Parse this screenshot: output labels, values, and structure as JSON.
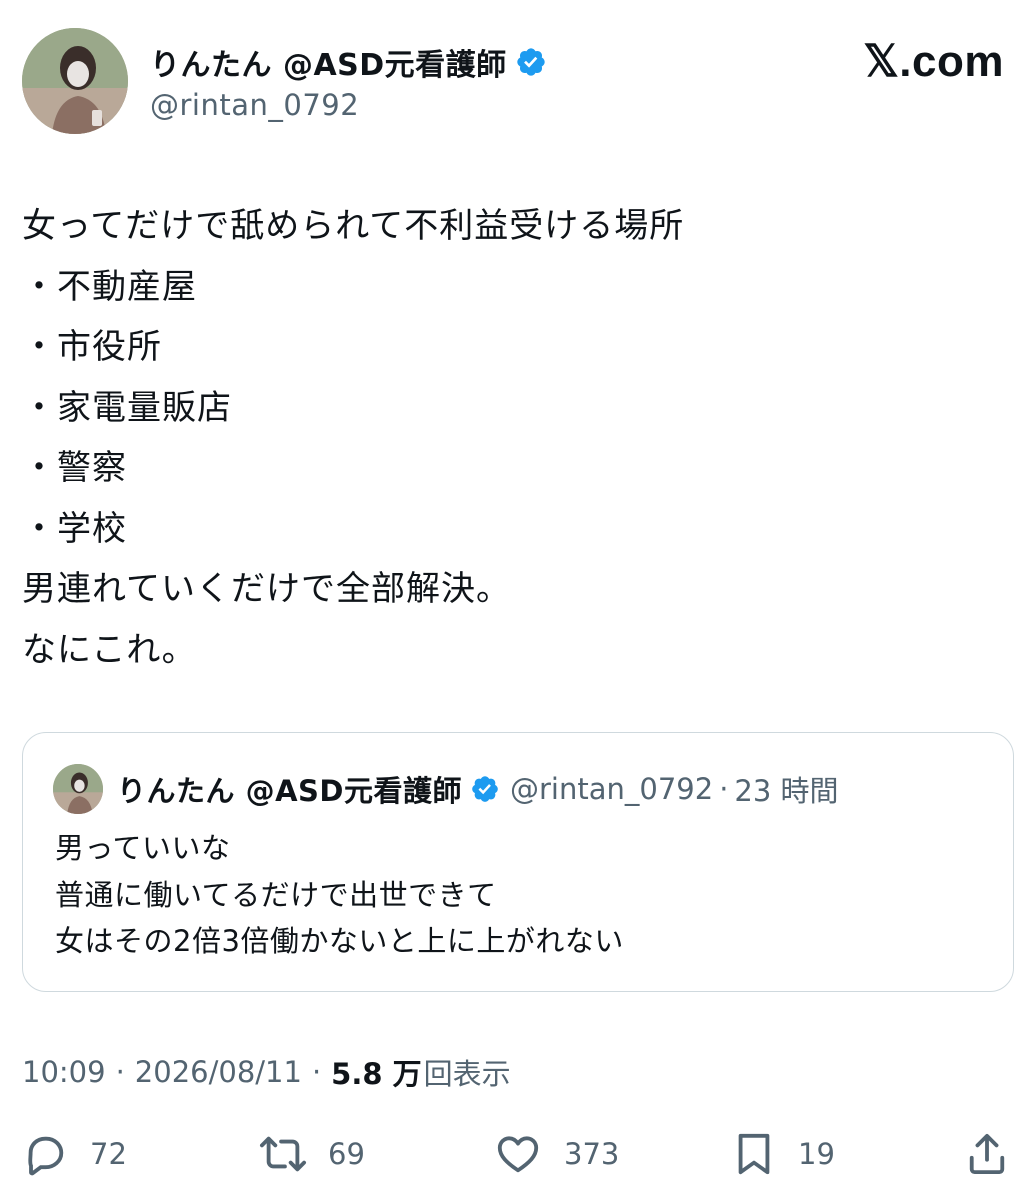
{
  "author": {
    "display_name": "りんたん @ASD元看護師",
    "handle": "@rintan_0792"
  },
  "brand": {
    "logo_text": "𝕏.com"
  },
  "tweet": {
    "lines": [
      "女ってだけで舐められて不利益受ける場所",
      "・不動産屋",
      "・市役所",
      "・家電量販店",
      "・警察",
      "・学校",
      "男連れていくだけで全部解決。",
      "なにこれ。"
    ]
  },
  "quote": {
    "display_name": "りんたん @ASD元看護師",
    "handle": "@rintan_0792",
    "separator": "·",
    "time": "23 時間",
    "lines": [
      "男っていいな",
      "普通に働いてるだけで出世できて",
      "女はその2倍3倍働かないと上に上がれない"
    ]
  },
  "meta": {
    "time": "10:09",
    "sep": "·",
    "date": "2026/08/11",
    "views_number": "5.8 万",
    "views_label": "回表示"
  },
  "actions": {
    "replies": "72",
    "reposts": "69",
    "likes": "373",
    "bookmarks": "19"
  },
  "colors": {
    "text": "#0f1419",
    "secondary": "#536471",
    "verified": "#1d9bf0",
    "border": "#cfd9de"
  },
  "icons": [
    "verified-badge-icon",
    "reply-icon",
    "repost-icon",
    "like-icon",
    "bookmark-icon",
    "share-icon"
  ]
}
